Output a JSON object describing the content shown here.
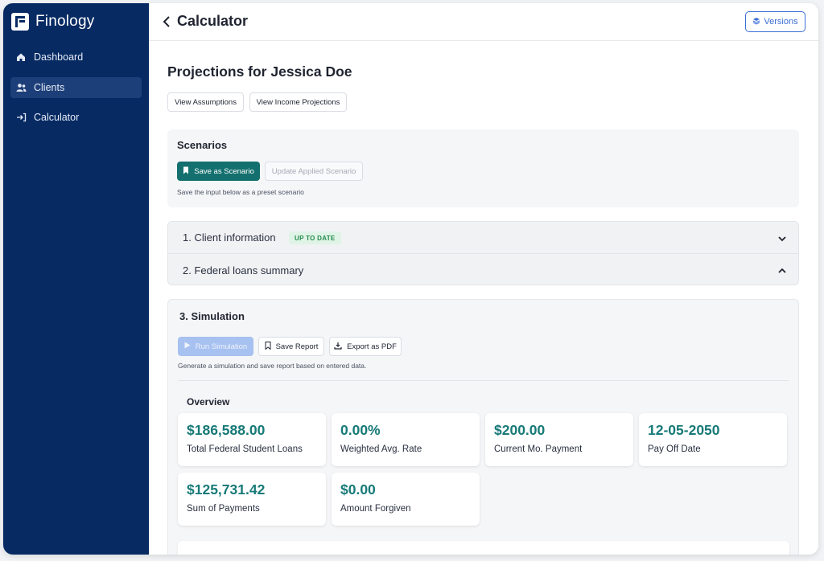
{
  "sidebar": {
    "brand": "Finology",
    "items": [
      {
        "label": "Dashboard",
        "icon": "home-icon"
      },
      {
        "label": "Clients",
        "icon": "users-icon",
        "active": true
      },
      {
        "label": "Calculator",
        "icon": "sign-in-icon"
      }
    ]
  },
  "header": {
    "title": "Calculator",
    "versions_label": "Versions"
  },
  "page": {
    "title": "Projections for Jessica Doe",
    "view_assumptions": "View Assumptions",
    "view_income_projections": "View Income Projections"
  },
  "scenarios": {
    "title": "Scenarios",
    "save_label": "Save as Scenario",
    "update_label": "Update Applied Scenario",
    "help": "Save the input below as a preset scenario"
  },
  "accordion": {
    "items": [
      {
        "label": "1. Client information",
        "badge": "UP TO DATE",
        "state": "collapsed"
      },
      {
        "label": "2. Federal loans summary",
        "state": "expanded"
      }
    ]
  },
  "simulation": {
    "title": "3. Simulation",
    "run_label": "Run Simulation",
    "save_report_label": "Save Report",
    "export_label": "Export as PDF",
    "help": "Generate a simulation and save report based on entered data.",
    "overview_title": "Overview",
    "stats": [
      {
        "value": "$186,588.00",
        "label": "Total Federal Student Loans"
      },
      {
        "value": "0.00%",
        "label": "Weighted Avg. Rate"
      },
      {
        "value": "$200.00",
        "label": "Current Mo. Payment"
      },
      {
        "value": "12-05-2050",
        "label": "Pay Off Date"
      },
      {
        "value": "$125,731.42",
        "label": "Sum of Payments"
      },
      {
        "value": "$0.00",
        "label": "Amount Forgiven"
      }
    ]
  },
  "colors": {
    "sidebar_bg": "#072a63",
    "accent_teal": "#14706e",
    "stat_value": "#177a78",
    "primary_blue": "#3b6fd6",
    "badge_green": "#248a4e"
  }
}
